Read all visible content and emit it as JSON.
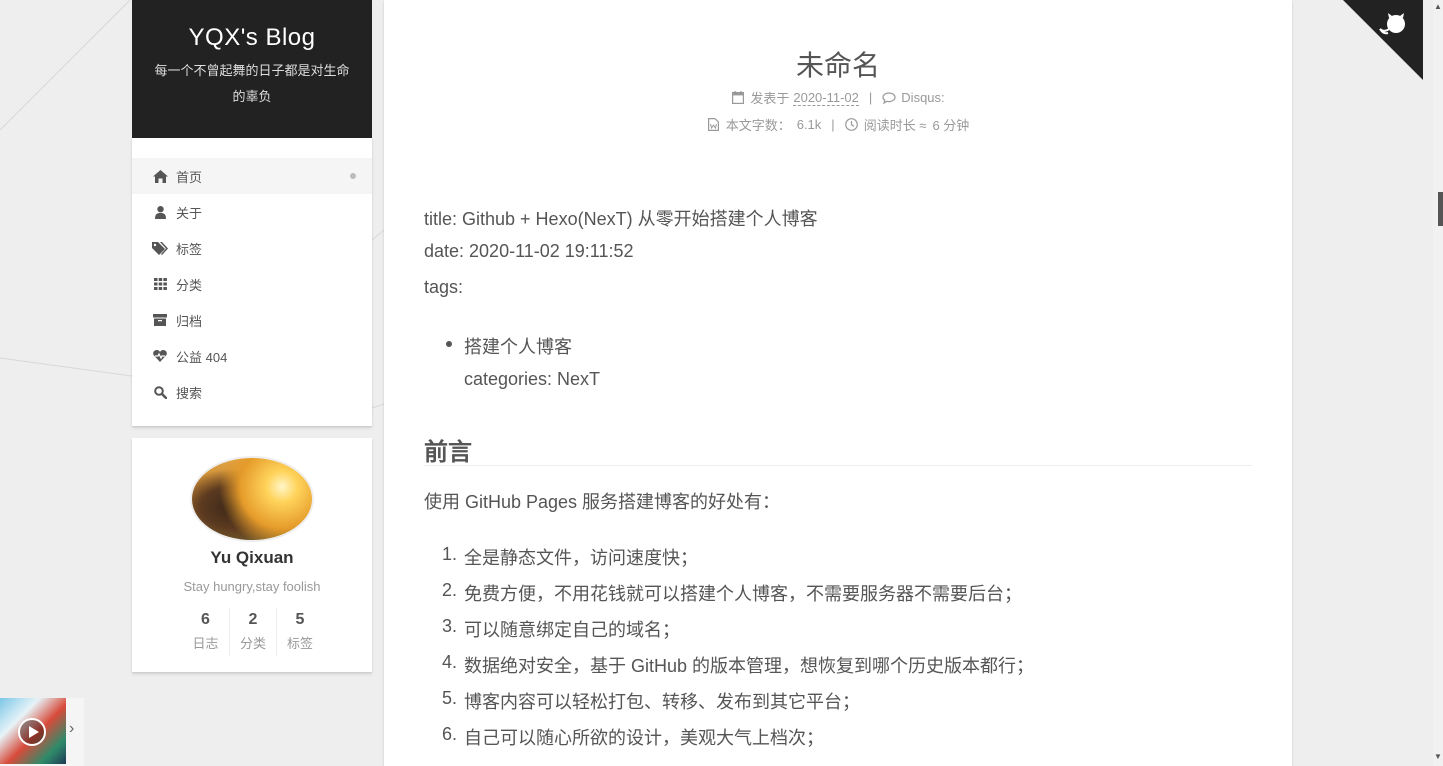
{
  "site": {
    "title": "YQX's Blog",
    "subtitle": "每一个不曾起舞的日子都是对生命的辜负"
  },
  "menu": [
    {
      "label": "首页",
      "icon": "home-icon",
      "active": true
    },
    {
      "label": "关于",
      "icon": "user-icon"
    },
    {
      "label": "标签",
      "icon": "tags-icon"
    },
    {
      "label": "分类",
      "icon": "th-grid-icon"
    },
    {
      "label": "归档",
      "icon": "archive-icon"
    },
    {
      "label": "公益 404",
      "icon": "heartbeat-icon"
    },
    {
      "label": "搜索",
      "icon": "search-icon"
    }
  ],
  "profile": {
    "name": "Yu Qixuan",
    "motto": "Stay hungry,stay foolish",
    "stats": [
      {
        "count": "6",
        "label": "日志"
      },
      {
        "count": "2",
        "label": "分类"
      },
      {
        "count": "5",
        "label": "标签"
      }
    ]
  },
  "post": {
    "title": "未命名",
    "posted_label": "发表于",
    "posted_date": "2020-11-02",
    "disqus_label": "Disqus:",
    "wordcount_label": "本文字数：",
    "wordcount": "6.1k",
    "readtime_label": "阅读时长 ≈",
    "readtime": "6 分钟",
    "front_matter": {
      "title_line": "title: Github + Hexo(NexT) 从零开始搭建个人博客",
      "date_line": "date: 2020-11-02 19:11:52",
      "tags_line": "tags:",
      "tag_item": "搭建个人博客",
      "categories_line": "categories: NexT"
    },
    "section_heading": "前言",
    "intro": "使用 GitHub Pages 服务搭建博客的好处有：",
    "benefits": [
      "全是静态文件，访问速度快；",
      "免费方便，不用花钱就可以搭建个人博客，不需要服务器不需要后台；",
      "可以随意绑定自己的域名；",
      "数据绝对安全，基于 GitHub 的版本管理，想恢复到哪个历史版本都行；",
      "博客内容可以轻松打包、转移、发布到其它平台；",
      "自己可以随心所欲的设计，美观大气上档次；"
    ]
  },
  "music": {
    "arrow": "›"
  },
  "colors": {
    "brand_bg": "#222222",
    "page_bg": "#eeeeee",
    "text": "#555555"
  }
}
